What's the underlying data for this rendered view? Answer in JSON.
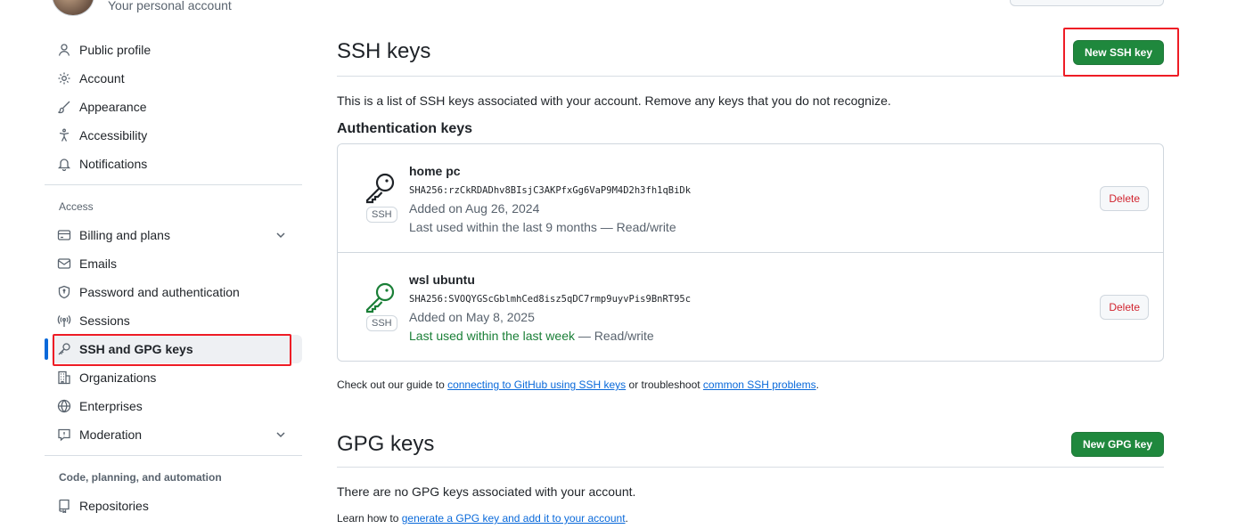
{
  "header": {
    "personal_account": "Your personal account"
  },
  "sidebar": {
    "items_top": [
      {
        "label": "Public profile",
        "icon": "person-icon"
      },
      {
        "label": "Account",
        "icon": "gear-icon"
      },
      {
        "label": "Appearance",
        "icon": "paintbrush-icon"
      },
      {
        "label": "Accessibility",
        "icon": "accessibility-icon"
      },
      {
        "label": "Notifications",
        "icon": "bell-icon"
      }
    ],
    "access_title": "Access",
    "items_access": [
      {
        "label": "Billing and plans",
        "icon": "credit-card-icon"
      },
      {
        "label": "Emails",
        "icon": "mail-icon"
      },
      {
        "label": "Password and authentication",
        "icon": "shield-lock-icon"
      },
      {
        "label": "Sessions",
        "icon": "broadcast-icon"
      },
      {
        "label": "SSH and GPG keys",
        "icon": "key-icon"
      },
      {
        "label": "Organizations",
        "icon": "organization-icon"
      },
      {
        "label": "Enterprises",
        "icon": "globe-icon"
      },
      {
        "label": "Moderation",
        "icon": "report-icon"
      }
    ],
    "code_title": "Code, planning, and automation",
    "items_code": [
      {
        "label": "Repositories",
        "icon": "repo-icon"
      }
    ]
  },
  "ssh": {
    "title": "SSH keys",
    "new_button": "New SSH key",
    "description": "This is a list of SSH keys associated with your account. Remove any keys that you do not recognize.",
    "auth_title": "Authentication keys",
    "keys": [
      {
        "name": "home pc",
        "fingerprint": "SHA256:rzCkRDADhv8BIsjC3AKPfxGg6VaP9M4D2h3fh1qBiDk",
        "added": "Added on Aug 26, 2024",
        "used_main": "Last used within the last 9 months",
        "used_suffix": " — Read/write",
        "badge": "SSH",
        "delete": "Delete",
        "color": "#1f2328"
      },
      {
        "name": "wsl ubuntu",
        "fingerprint": "SHA256:SVOQYGScGblmhCed8isz5qDC7rmp9uyvPis9BnRT95c",
        "added": "Added on May 8, 2025",
        "used_main": "Last used within the last week",
        "used_suffix": " — Read/write",
        "badge": "SSH",
        "delete": "Delete",
        "color": "#1a7f37"
      }
    ],
    "guide_prefix": "Check out our guide to ",
    "guide_link1": "connecting to GitHub using SSH keys",
    "guide_mid": " or troubleshoot ",
    "guide_link2": "common SSH problems",
    "guide_suffix": "."
  },
  "gpg": {
    "title": "GPG keys",
    "new_button": "New GPG key",
    "empty": "There are no GPG keys associated with your account.",
    "learn_prefix": "Learn how to ",
    "learn_link": "generate a GPG key and add it to your account",
    "learn_suffix": "."
  },
  "colors": {
    "accent": "#0969da",
    "primary_button": "#1f883d",
    "danger": "#d1242f",
    "highlight": "#ee1c25"
  }
}
